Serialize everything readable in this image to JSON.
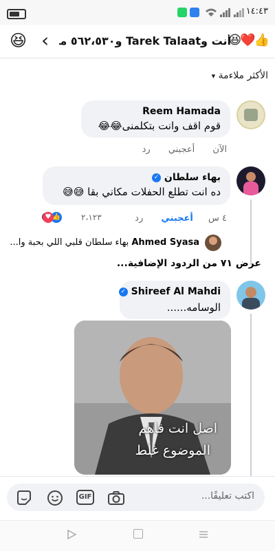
{
  "status_bar": {
    "time": "١٤:٤٣"
  },
  "header": {
    "title": "أنت وTarek Talaat و٥٦٢،٥٣٠ من ...",
    "left_emoji": "😆",
    "reaction_emojis": "😆❤️👍"
  },
  "sort": {
    "label": "الأكثر ملاءمة"
  },
  "comments": [
    {
      "name": "Reem Hamada",
      "text": "قوم اقف وانت بتكلمنى😂😂",
      "time": "الآن",
      "like": "أعجبني",
      "reply": "رد"
    },
    {
      "name": "بهاء سلطان",
      "text": "ده انت تطلع الحفلات مكاني بقا 😅😅",
      "time": "٤ س",
      "like": "أعجبني",
      "reply": "رد",
      "reactions_count": "٢،١٢٣",
      "reply_preview": {
        "name": "Ahmed Syasa",
        "text": "بهاء سلطان  قلبي اللي بحبة وا..."
      },
      "more_replies": "عرض ٧١ من الردود الإضافية..."
    },
    {
      "name": "Shireef Al Mahdi",
      "text": "الوسامه......",
      "image_caption_line1": "اصل انت فاهم",
      "image_caption_line2": "الموضوع غلط"
    }
  ],
  "composer": {
    "placeholder": "اكتب تعليقًا...",
    "gif_label": "GIF"
  },
  "colors": {
    "accent": "#1877f2",
    "bubble": "#f0f2f5",
    "love": "#f33e58",
    "haha": "#f7b125"
  }
}
